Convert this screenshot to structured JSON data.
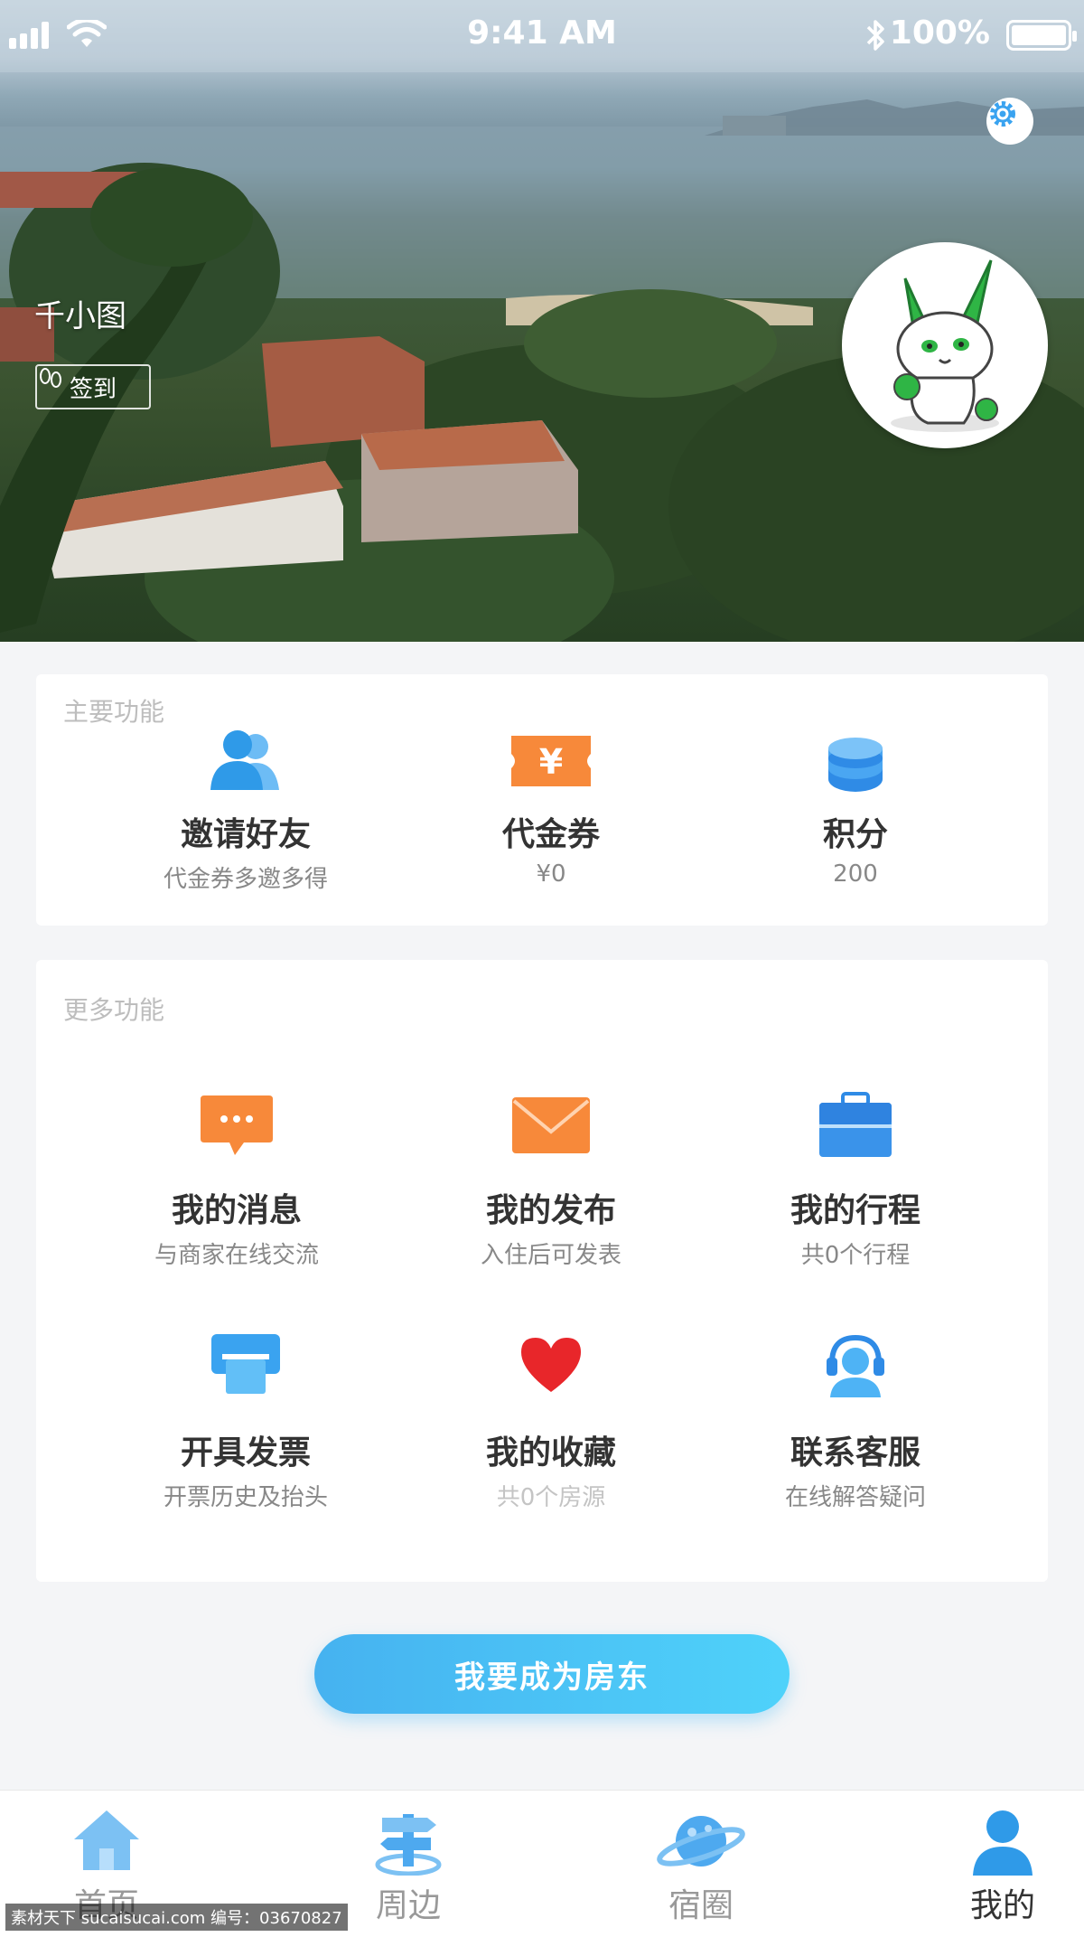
{
  "status_bar": {
    "time": "9:41 AM",
    "battery": "100%"
  },
  "profile": {
    "username": "千小图",
    "signin_label": "签到"
  },
  "main_section": {
    "title": "主要功能",
    "items": [
      {
        "label": "邀请好友",
        "sub": "代金券多邀多得",
        "icon": "users-icon"
      },
      {
        "label": "代金券",
        "sub": "¥0",
        "icon": "coupon-icon"
      },
      {
        "label": "积分",
        "sub": "200",
        "icon": "points-icon"
      }
    ]
  },
  "more_section": {
    "title": "更多功能",
    "items": [
      {
        "label": "我的消息",
        "sub": "与商家在线交流",
        "icon": "message-icon"
      },
      {
        "label": "我的发布",
        "sub": "入住后可发表",
        "icon": "envelope-icon"
      },
      {
        "label": "我的行程",
        "sub": "共0个行程",
        "icon": "suitcase-icon"
      },
      {
        "label": "开具发票",
        "sub": "开票历史及抬头",
        "icon": "printer-icon"
      },
      {
        "label": "我的收藏",
        "sub": "共0个房源",
        "icon": "heart-icon"
      },
      {
        "label": "联系客服",
        "sub": "在线解答疑问",
        "icon": "headset-icon"
      }
    ]
  },
  "cta_label": "我要成为房东",
  "tabs": [
    {
      "label": "首页",
      "icon": "home-icon"
    },
    {
      "label": "周边",
      "icon": "signpost-icon"
    },
    {
      "label": "宿圈",
      "icon": "planet-icon"
    },
    {
      "label": "我的",
      "icon": "user-icon",
      "active": true
    }
  ],
  "watermark": "素材天下 sucaisucai.com  编号：03670827",
  "colors": {
    "accent_blue": "#3aa3f0",
    "orange": "#f7893a",
    "heart_red": "#e8262a",
    "cta_gradient": [
      "#46b2f0",
      "#4fd2fa"
    ]
  }
}
